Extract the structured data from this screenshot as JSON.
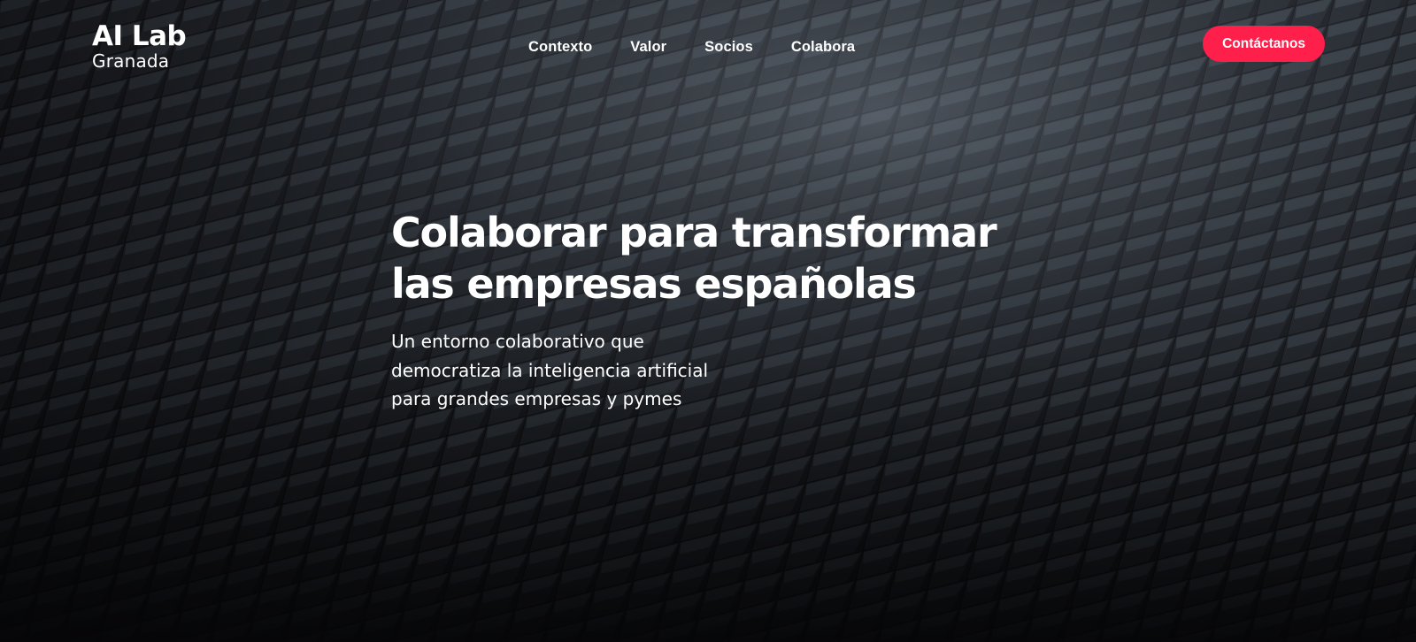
{
  "brand": {
    "name": "AI Lab",
    "location": "Granada"
  },
  "nav": {
    "items": [
      {
        "label": "Contexto"
      },
      {
        "label": "Valor"
      },
      {
        "label": "Socios"
      },
      {
        "label": "Colabora"
      }
    ],
    "cta_label": "Contáctanos"
  },
  "hero": {
    "headline_lines": [
      "Colaborar para transformar",
      "las empresas españolas"
    ],
    "subtitle_lines": [
      "Un entorno colaborativo que",
      "democratiza la inteligencia artificial",
      "para grandes empresas y pymes"
    ],
    "background": "dark-geometric-tiles"
  },
  "colors": {
    "accent": "#ff1f4b",
    "text": "#ffffff",
    "background": "#0b0b0e"
  }
}
